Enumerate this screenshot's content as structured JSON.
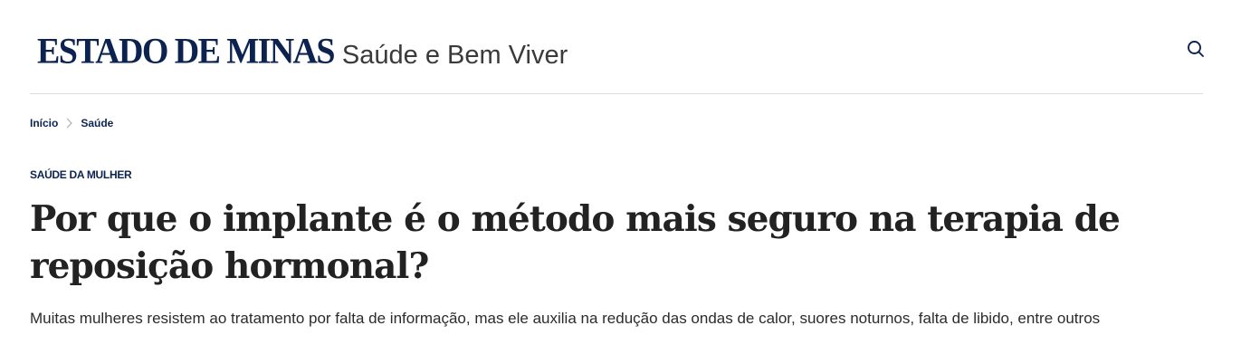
{
  "header": {
    "brand": "ESTADO DE MINAS",
    "section": "Saúde e Bem Viver",
    "search_icon": "search-icon"
  },
  "breadcrumb": {
    "items": [
      {
        "label": "Início"
      },
      {
        "label": "Saúde"
      }
    ],
    "separator_icon": "chevron-right-icon"
  },
  "article": {
    "kicker": "SAÚDE DA MULHER",
    "title": "Por que o implante é o método mais seguro na terapia de reposição hormonal?",
    "subtitle": "Muitas mulheres resistem ao tratamento por falta de informação, mas ele auxilia na redução das ondas de calor, suores noturnos, falta de libido, entre outros"
  },
  "colors": {
    "brand": "#0c2350",
    "text": "#222222",
    "divider": "#dcdcdc"
  }
}
